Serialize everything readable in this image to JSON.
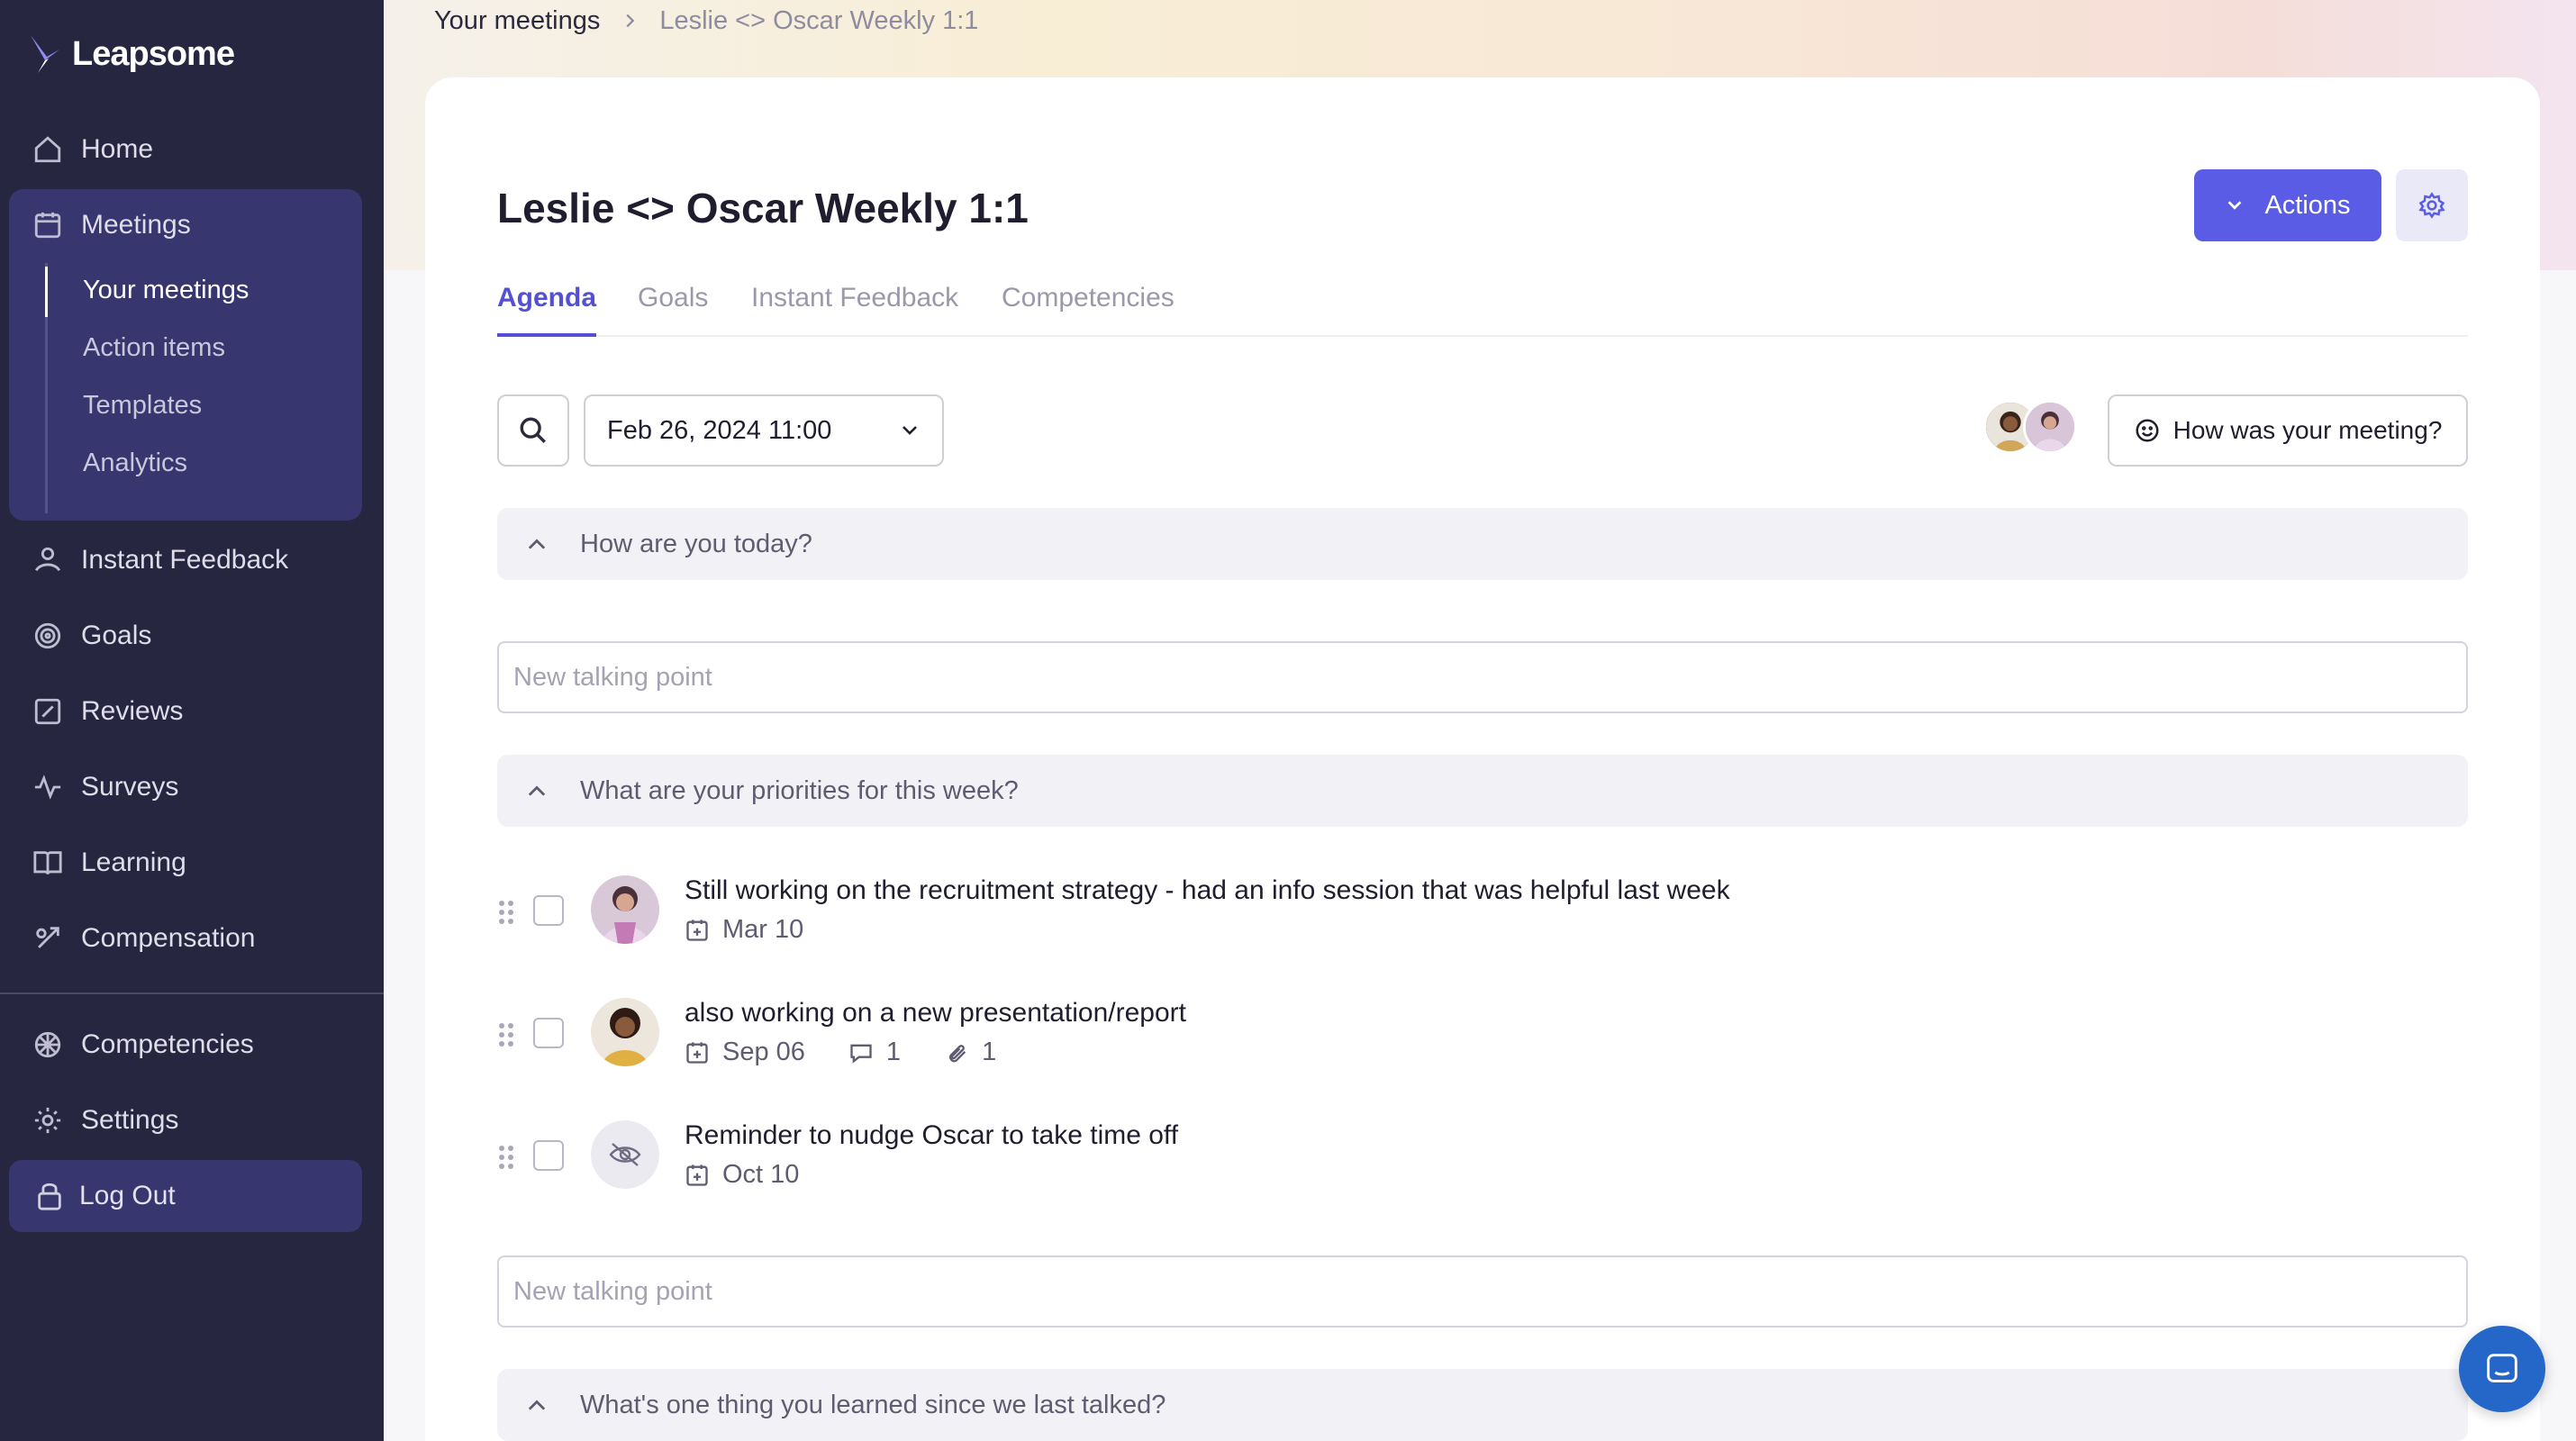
{
  "app": {
    "name": "Leapsome"
  },
  "sidebar": {
    "items": [
      {
        "label": "Home",
        "icon": "home-icon"
      },
      {
        "label": "Meetings",
        "icon": "meetings-icon"
      },
      {
        "label": "Instant Feedback",
        "icon": "feedback-icon"
      },
      {
        "label": "Goals",
        "icon": "goals-icon"
      },
      {
        "label": "Reviews",
        "icon": "reviews-icon"
      },
      {
        "label": "Surveys",
        "icon": "surveys-icon"
      },
      {
        "label": "Learning",
        "icon": "learning-icon"
      },
      {
        "label": "Compensation",
        "icon": "compensation-icon"
      },
      {
        "label": "Competencies",
        "icon": "competencies-icon"
      },
      {
        "label": "Settings",
        "icon": "settings-icon"
      }
    ],
    "meetings_sub": [
      "Your meetings",
      "Action items",
      "Templates",
      "Analytics"
    ],
    "logout": "Log Out"
  },
  "breadcrumb": {
    "parent": "Your meetings",
    "current": "Leslie <> Oscar Weekly 1:1"
  },
  "page": {
    "title": "Leslie <> Oscar Weekly 1:1",
    "actions_label": "Actions",
    "tabs": [
      "Agenda",
      "Goals",
      "Instant Feedback",
      "Competencies"
    ],
    "active_tab": "Agenda"
  },
  "toolbar": {
    "meeting_date": "Feb 26, 2024 11:00",
    "feedback_label": "How was your meeting?"
  },
  "agenda": {
    "sections": [
      {
        "title": "How are you today?",
        "input_placeholder": "New talking point"
      },
      {
        "title": "What are your priorities for this week?",
        "input_placeholder": "New talking point"
      },
      {
        "title": "What's one thing you learned since we last talked?"
      }
    ],
    "items": [
      {
        "text": "Still working on the recruitment strategy - had an info session that was helpful last week",
        "date": "Mar 10"
      },
      {
        "text": "also working on a new presentation/report",
        "date": "Sep 06",
        "comments": "1",
        "attachments": "1"
      },
      {
        "text": "Reminder to nudge Oscar to take time off",
        "date": "Oct 10",
        "private": true
      }
    ]
  },
  "colors": {
    "sidebar_bg": "#272640",
    "sidebar_active_bg": "#37366e",
    "accent": "#5b5ce6",
    "chat_bubble": "#2567c8"
  }
}
